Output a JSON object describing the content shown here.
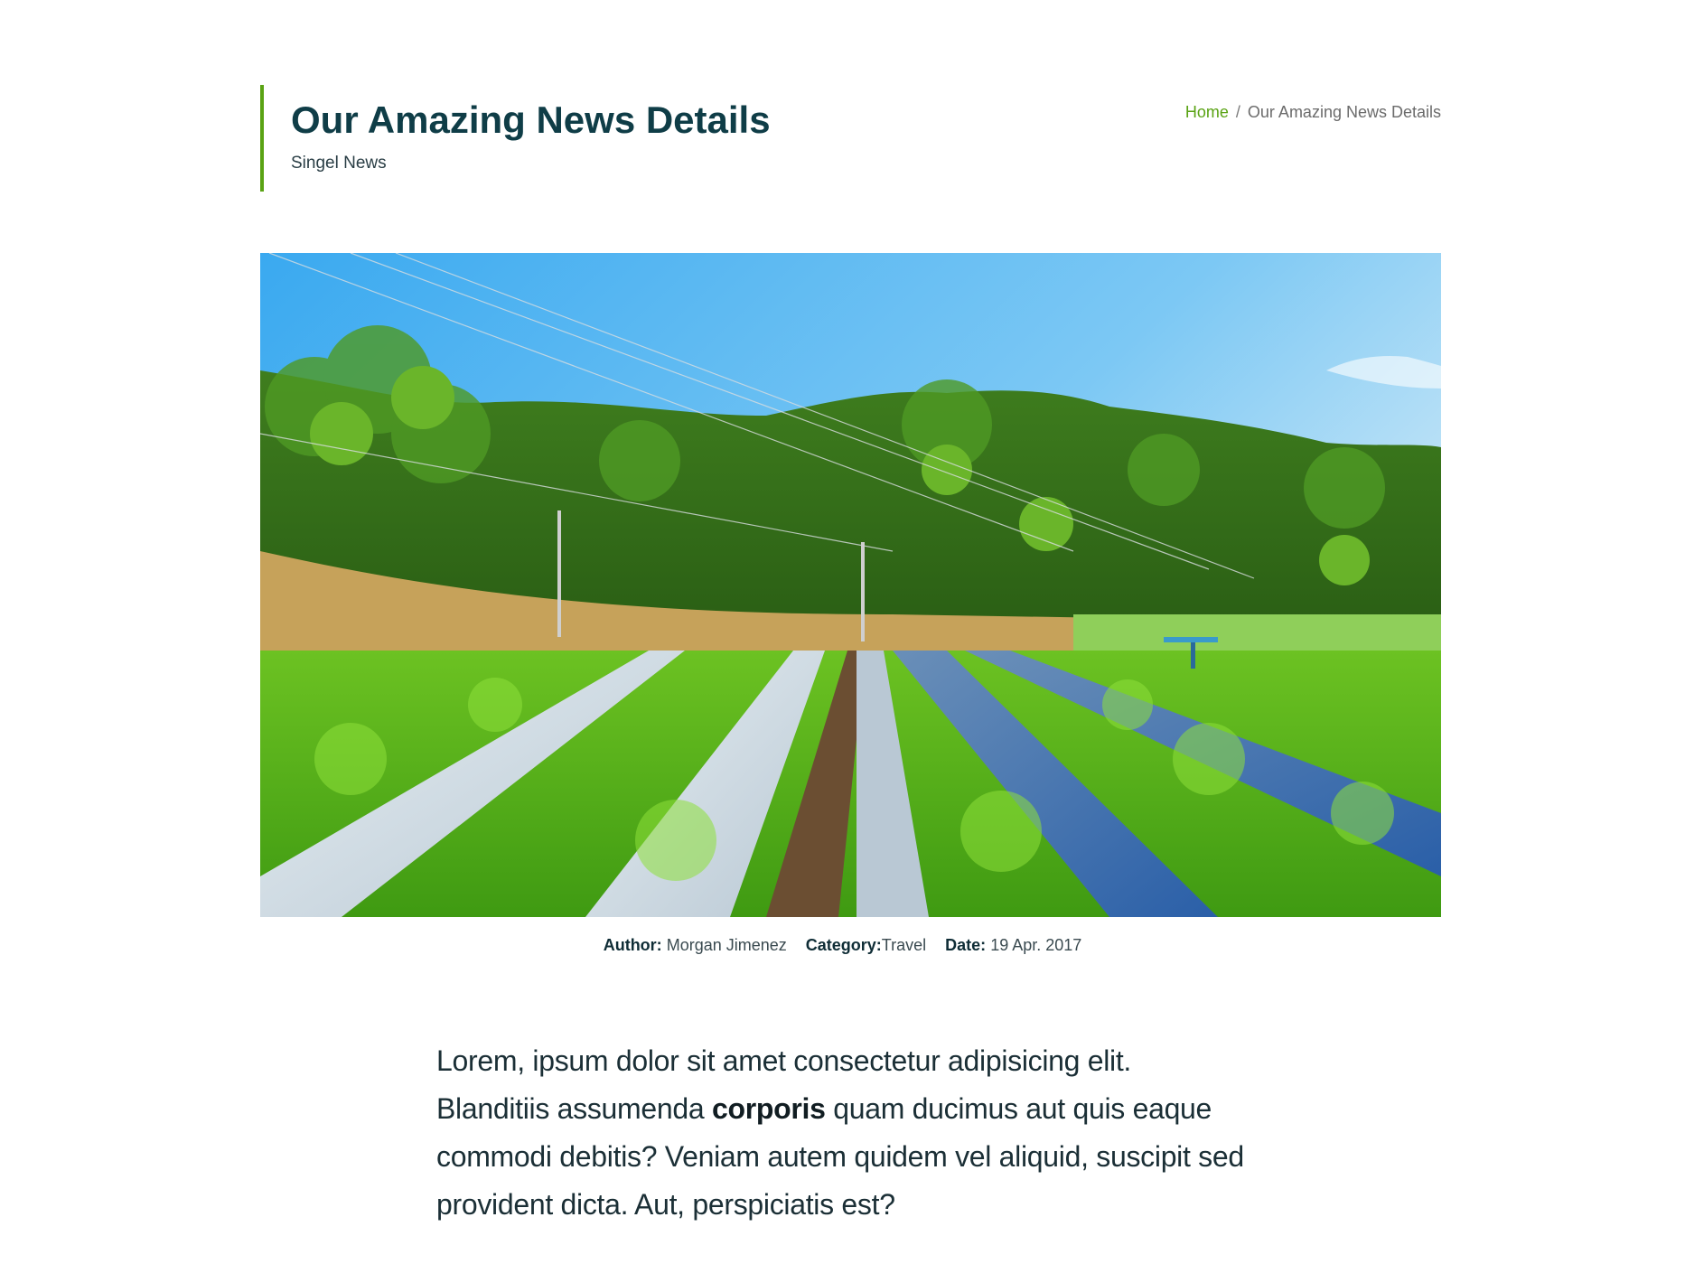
{
  "header": {
    "title": "Our Amazing News Details",
    "subtitle": "Singel News",
    "accent_color": "#5aa314"
  },
  "breadcrumb": {
    "home": "Home",
    "separator": "/",
    "current": "Our Amazing News Details"
  },
  "hero": {
    "alt": "Strawberry farm rows under a blue sky with forested hills"
  },
  "meta": {
    "author_label": "Author:",
    "author": "Morgan Jimenez",
    "category_label": "Category:",
    "category": "Travel",
    "date_label": "Date:",
    "date": "19 Apr. 2017"
  },
  "article": {
    "text_before": "Lorem, ipsum dolor sit amet consectetur adipisicing elit. Blanditiis assumenda ",
    "bold": "corporis",
    "text_after": " quam ducimus aut quis eaque commodi debitis? Veniam autem quidem vel aliquid, suscipit sed provident dicta. Aut, perspiciatis est?"
  }
}
